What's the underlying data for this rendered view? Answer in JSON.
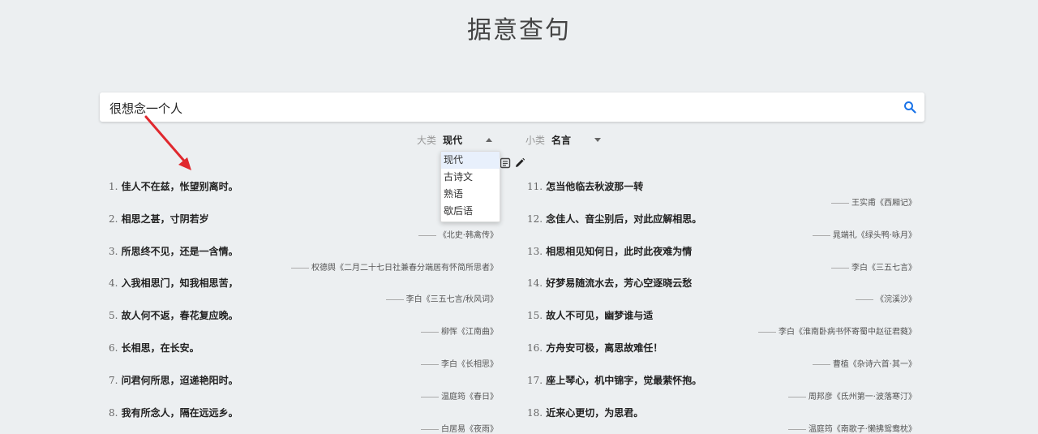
{
  "title": "据意查句",
  "search": {
    "value": "很想念一个人"
  },
  "filters": {
    "category": {
      "label": "大类",
      "value": "现代"
    },
    "subcategory": {
      "label": "小类",
      "value": "名言"
    }
  },
  "dropdown_options": [
    "现代",
    "古诗文",
    "熟语",
    "歇后语"
  ],
  "quotes_left": [
    {
      "num": "1.",
      "text": "佳人不在兹，怅望别离时。",
      "source": ""
    },
    {
      "num": "2.",
      "text": "相思之甚，寸阴若岁",
      "source": "《北史·韩禽传》"
    },
    {
      "num": "3.",
      "text": "所思终不见，还是一含情。",
      "source": "权德舆《二月二十七日社兼春分端居有怀简所思者》"
    },
    {
      "num": "4.",
      "text": "入我相思门，知我相思苦，",
      "source": "李白《三五七言/秋风词》"
    },
    {
      "num": "5.",
      "text": "故人何不返，春花复应晚。",
      "source": "柳恽《江南曲》"
    },
    {
      "num": "6.",
      "text": "长相思，在长安。",
      "source": "李白《长相思》"
    },
    {
      "num": "7.",
      "text": "问君何所思，迢递艳阳时。",
      "source": "温庭筠《春日》"
    },
    {
      "num": "8.",
      "text": "我有所念人，隔在远远乡。",
      "source": "白居易《夜雨》"
    }
  ],
  "quotes_right": [
    {
      "num": "11.",
      "text": "怎当他临去秋波那一转",
      "source": "王实甫《西厢记》"
    },
    {
      "num": "12.",
      "text": "念佳人、音尘别后，对此应解相思。",
      "source": "晁端礼《绿头鸭·咏月》"
    },
    {
      "num": "13.",
      "text": "相思相见知何日，此时此夜难为情",
      "source": "李白《三五七言》"
    },
    {
      "num": "14.",
      "text": "好梦易随流水去，芳心空逐晓云愁",
      "source": "《浣溪沙》"
    },
    {
      "num": "15.",
      "text": "故人不可见，幽梦谁与适",
      "source": "李白《淮南卧病书怀寄蜀中赵征君蕤》"
    },
    {
      "num": "16.",
      "text": "方舟安可极，离思故难任！",
      "source": "曹植《杂诗六首·其一》"
    },
    {
      "num": "17.",
      "text": "座上琴心，机中锦字，觉最萦怀抱。",
      "source": "周邦彦《氐州第一·波落寒汀》"
    },
    {
      "num": "18.",
      "text": "近来心更切，为思君。",
      "source": "温庭筠《南歌子·懒拂鸳鸯枕》"
    }
  ]
}
